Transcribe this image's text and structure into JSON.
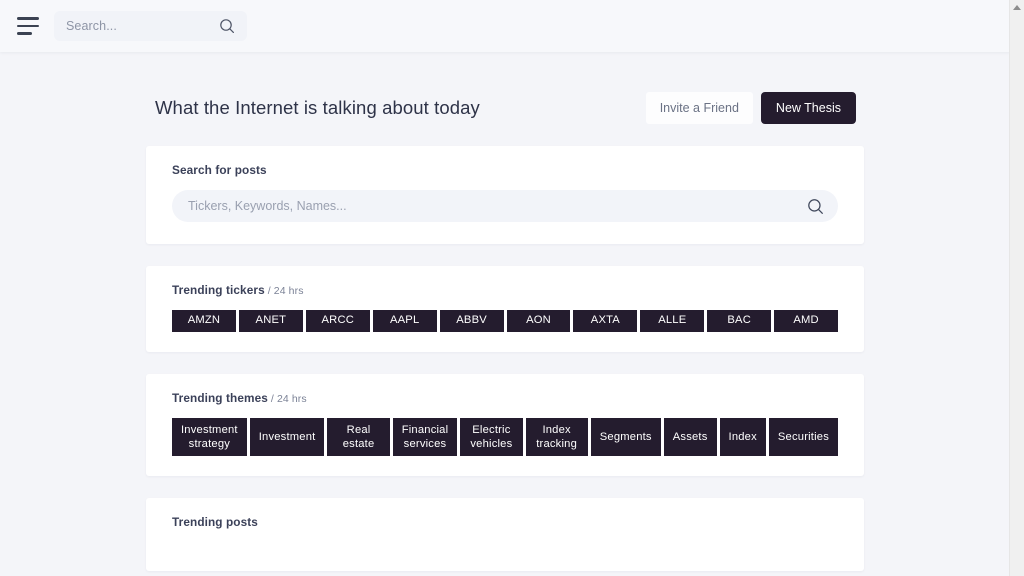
{
  "topbar": {
    "menu_icon": "hamburger-icon",
    "search": {
      "placeholder": "Search...",
      "value": "",
      "icon": "search-icon"
    }
  },
  "header": {
    "title": "What the Internet is talking about today",
    "invite_label": "Invite a Friend",
    "new_thesis_label": "New Thesis"
  },
  "search_card": {
    "label": "Search for posts",
    "placeholder": "Tickers, Keywords, Names...",
    "value": "",
    "icon": "search-icon"
  },
  "tickers_card": {
    "label": "Trending tickers",
    "sub": " / 24 hrs",
    "items": [
      "AMZN",
      "ANET",
      "ARCC",
      "AAPL",
      "ABBV",
      "AON",
      "AXTA",
      "ALLE",
      "BAC",
      "AMD"
    ]
  },
  "themes_card": {
    "label": "Trending themes",
    "sub": " / 24 hrs",
    "items": [
      "Investment strategy",
      "Investment",
      "Real estate",
      "Financial services",
      "Electric vehicles",
      "Index tracking",
      "Segments",
      "Assets",
      "Index",
      "Securities"
    ]
  },
  "posts_card": {
    "label": "Trending posts"
  },
  "colors": {
    "accent_dark": "#241c2e",
    "page_bg": "#f4f5f9",
    "card_bg": "#ffffff",
    "title_text": "#2e3348"
  }
}
